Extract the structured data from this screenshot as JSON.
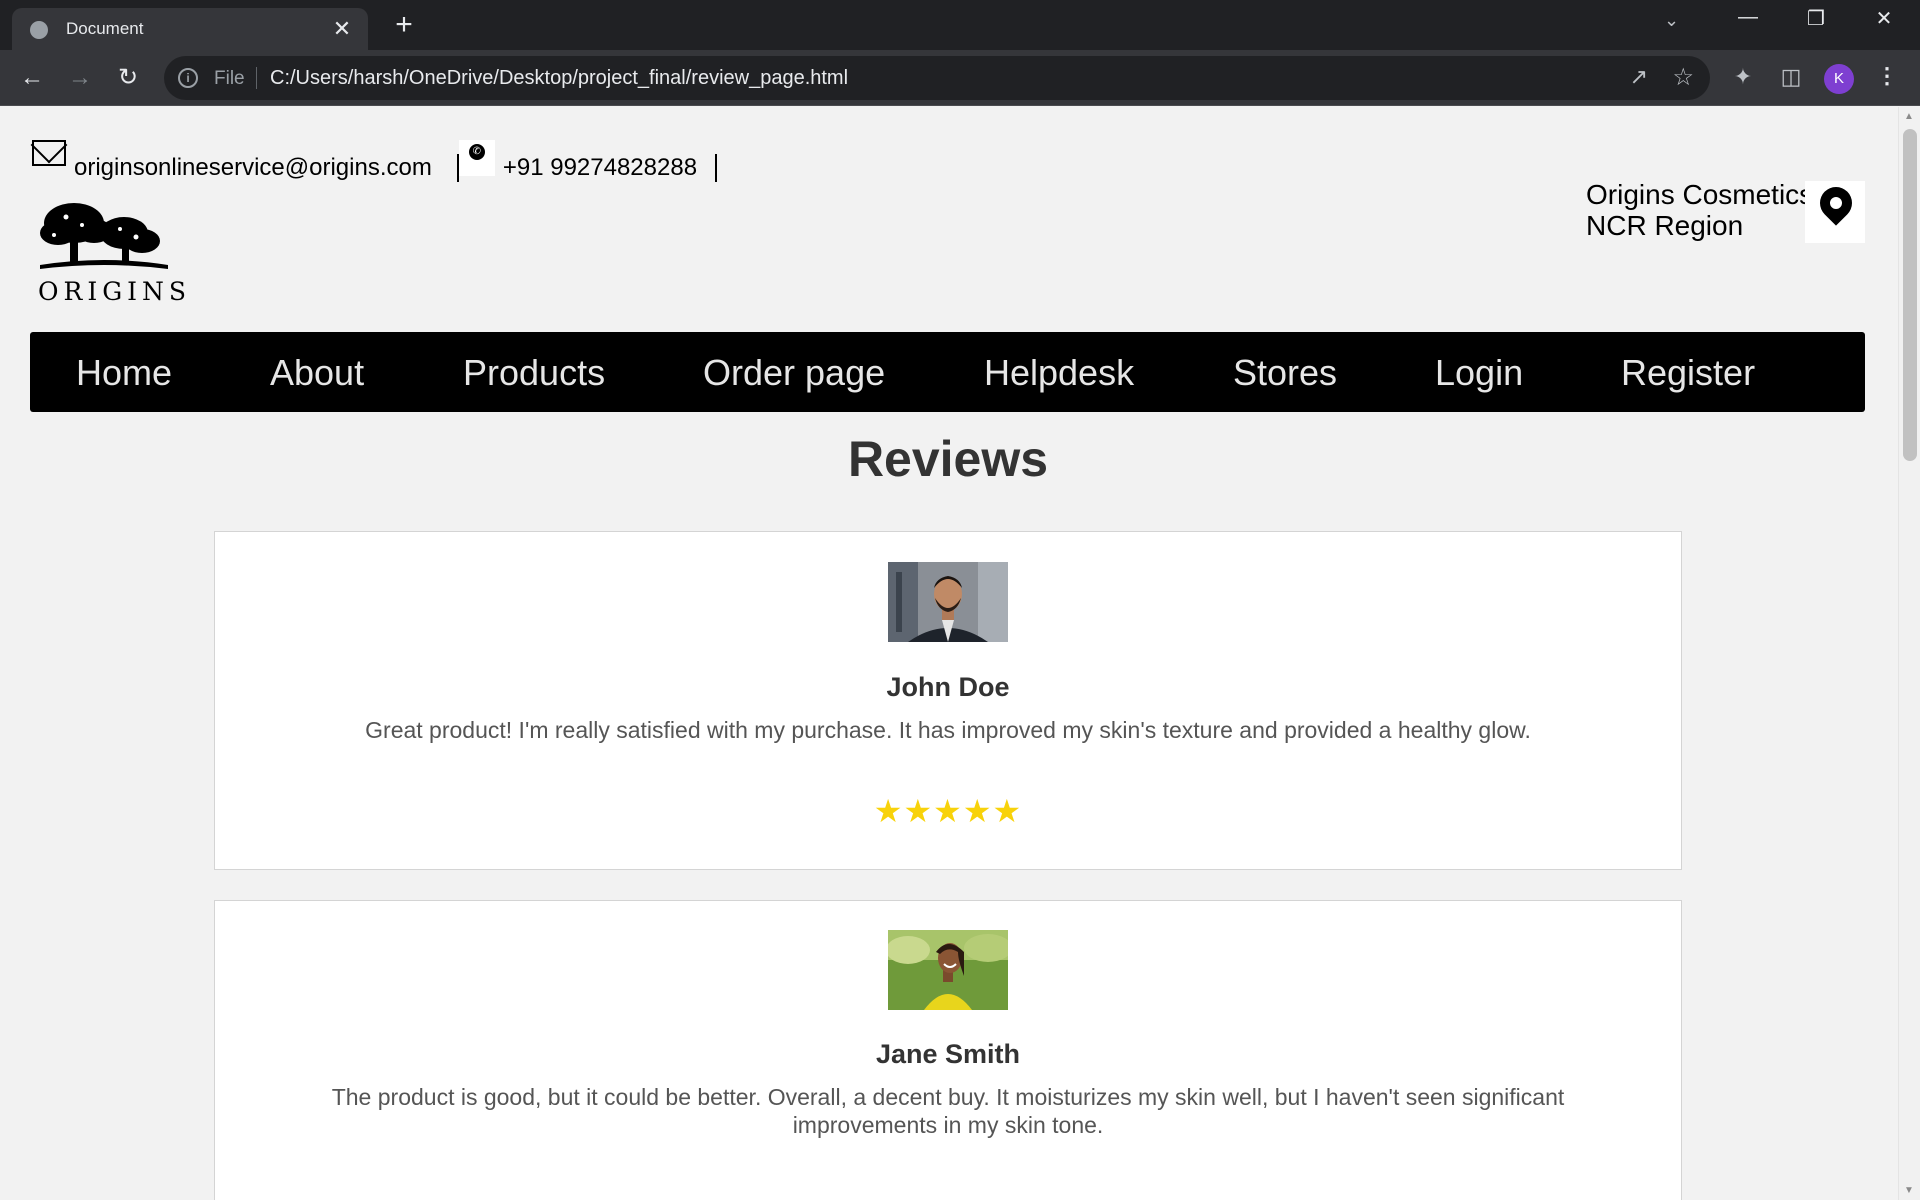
{
  "browser": {
    "tab_title": "Document",
    "tab_close": "✕",
    "new_tab": "+",
    "scheme_label": "File",
    "url": "C:/Users/harsh/OneDrive/Desktop/project_final/review_page.html",
    "profile_initial": "K",
    "window_controls": [
      "minimize-icon",
      "restore-icon",
      "close-icon"
    ]
  },
  "header": {
    "email": "originsonlineservice@origins.com",
    "phone": "+91 99274828288",
    "logo_text": "ORIGINS",
    "store_name": "Origins Cosmetics",
    "store_region": "NCR Region"
  },
  "nav": {
    "items": [
      "Home",
      "About",
      "Products",
      "Order page",
      "Helpdesk",
      "Stores",
      "Login",
      "Register"
    ]
  },
  "page": {
    "title": "Reviews"
  },
  "reviews": [
    {
      "name": "John Doe",
      "text": "Great product! I'm really satisfied with my purchase. It has improved my skin's texture and provided a healthy glow.",
      "stars": "★★★★★",
      "rating": 5
    },
    {
      "name": "Jane Smith",
      "text": "The product is good, but it could be better. Overall, a decent buy. It moisturizes my skin well, but I haven't seen significant improvements in my skin tone."
    }
  ],
  "colors": {
    "nav_bg": "#000000",
    "nav_text": "#e6e6e6",
    "star": "#f8d20a",
    "page_bg": "#f2f2f2"
  }
}
